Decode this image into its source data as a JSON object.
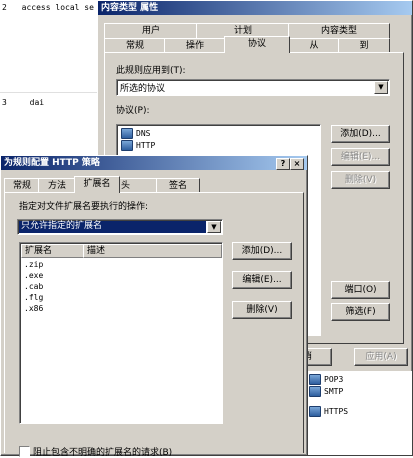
{
  "background_lines": [
    {
      "num": "2",
      "text": "access local se"
    },
    {
      "num": "3",
      "text": "dai"
    }
  ],
  "rule_props": {
    "title": "内容类型 属性",
    "tabs_back": [
      "用户",
      "计划",
      "内容类型"
    ],
    "tabs_front": [
      "常规",
      "操作",
      "协议",
      "从",
      "到"
    ],
    "applies_label": "此规则应用到(T):",
    "applies_value": "所选的协议",
    "protocols_label": "协议(P):",
    "protocols": [
      "DNS",
      "HTTP"
    ],
    "protocols_lower": [
      "POP3",
      "SMTP",
      "HTTPS"
    ],
    "btn_add": "添加(D)...",
    "btn_edit": "编辑(E)...",
    "btn_delete": "删除(V)",
    "btn_ports": "端口(O)",
    "btn_filter": "筛选(F)",
    "btn_cancel": "取消",
    "btn_apply": "应用(A)"
  },
  "http_policy": {
    "title": "为规则配置 HTTP 策略",
    "tabs": [
      "常规",
      "方法",
      "扩展名",
      "头",
      "签名"
    ],
    "specify_label": "指定对文件扩展名要执行的操作:",
    "action_value": "只允许指定的扩展名",
    "col_ext": "扩展名",
    "col_desc": "描述",
    "extensions": [
      ".zip",
      ".exe",
      ".cab",
      ".flg",
      ".x86"
    ],
    "btn_add": "添加(D)...",
    "btn_edit": "编辑(E)...",
    "btn_delete": "删除(V)",
    "checkbox_label": "阻止包含不明确的扩展名的请求(B)"
  }
}
